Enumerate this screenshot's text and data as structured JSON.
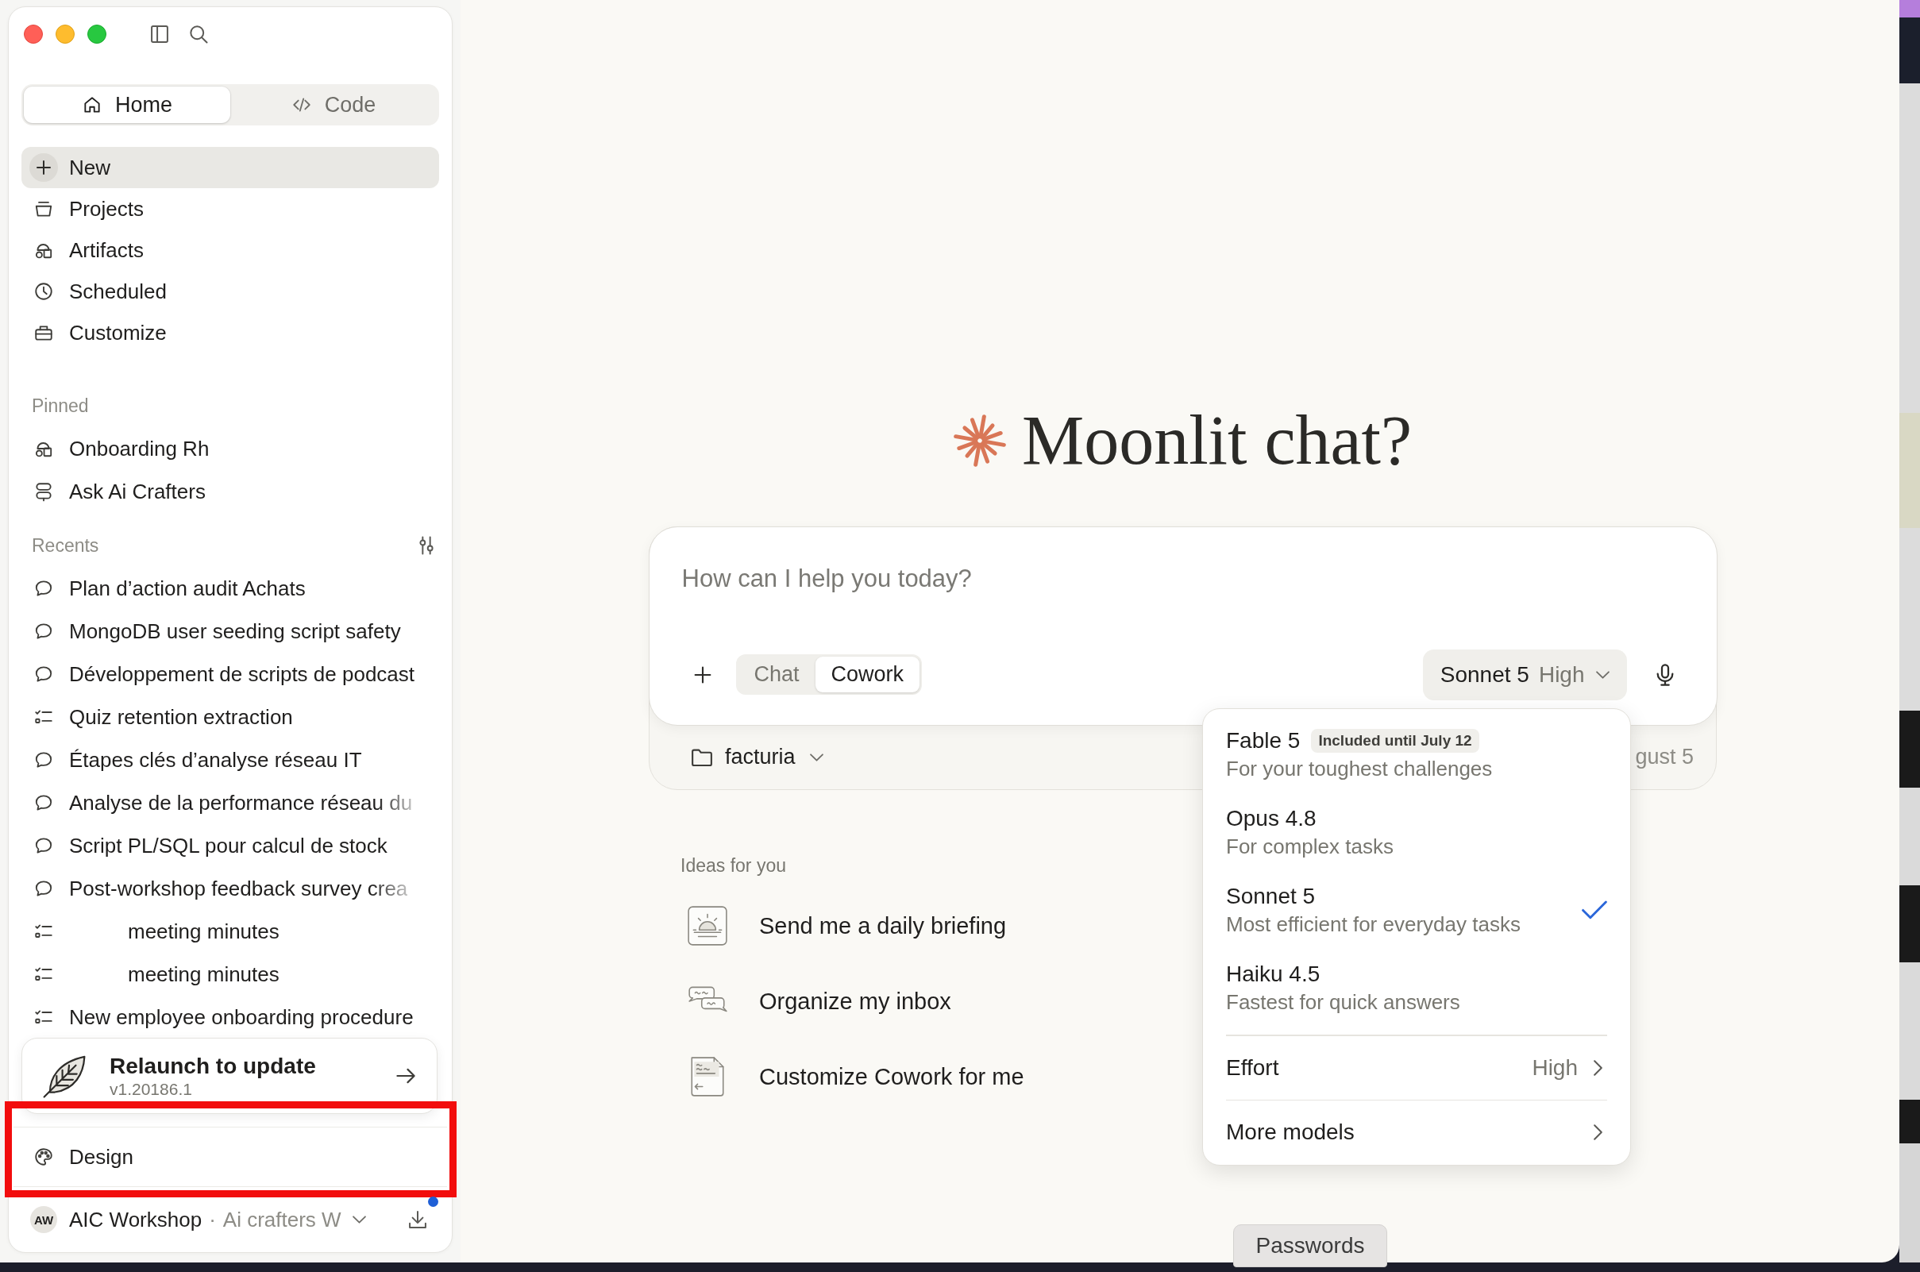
{
  "sidebar": {
    "mode_tabs": [
      {
        "label": "Home",
        "selected": true
      },
      {
        "label": "Code",
        "selected": false
      }
    ],
    "nav_items": [
      {
        "label": "New",
        "selected": true
      },
      {
        "label": "Projects",
        "selected": false
      },
      {
        "label": "Artifacts",
        "selected": false
      },
      {
        "label": "Scheduled",
        "selected": false
      },
      {
        "label": "Customize",
        "selected": false
      }
    ],
    "pinned": {
      "title": "Pinned",
      "items": [
        {
          "label": "Onboarding Rh"
        },
        {
          "label": "Ask Ai Crafters"
        }
      ]
    },
    "recents": {
      "title": "Recents",
      "items": [
        {
          "title": "Plan d’action audit Achats",
          "kind": "chat",
          "faded": false,
          "redacted": false
        },
        {
          "title": "MongoDB user seeding script safety",
          "kind": "chat",
          "faded": false,
          "redacted": false
        },
        {
          "title": "Développement de scripts de podcast",
          "kind": "chat",
          "faded": false,
          "redacted": false
        },
        {
          "title": "Quiz retention extraction",
          "kind": "task",
          "faded": false,
          "redacted": false
        },
        {
          "title": "Étapes clés d’analyse réseau IT",
          "kind": "chat",
          "faded": false,
          "redacted": false
        },
        {
          "title": "Analyse de la performance réseau du",
          "kind": "chat",
          "faded": true,
          "redacted": false
        },
        {
          "title": "Script PL/SQL pour calcul de stock",
          "kind": "chat",
          "faded": false,
          "redacted": false
        },
        {
          "title": "Post-workshop feedback survey crea",
          "kind": "chat",
          "faded": true,
          "redacted": false
        },
        {
          "title": "meeting minutes",
          "kind": "task",
          "faded": false,
          "redacted": true
        },
        {
          "title": "meeting minutes",
          "kind": "task",
          "faded": false,
          "redacted": true
        },
        {
          "title": "New employee onboarding procedure",
          "kind": "task",
          "faded": false,
          "redacted": false
        }
      ]
    },
    "update_card": {
      "title": "Relaunch to update",
      "version": "v1.20186.1"
    },
    "footer_items": [
      {
        "label": "Design",
        "highlighted": true
      }
    ],
    "account": {
      "initials": "AW",
      "name": "AIC Workshop",
      "separator": "·",
      "workspace": "Ai crafters W",
      "notification": true
    }
  },
  "main": {
    "greeting": "Moonlit chat?",
    "composer": {
      "placeholder": "How can I help you today?",
      "modes": [
        {
          "label": "Chat",
          "selected": false
        },
        {
          "label": "Cowork",
          "selected": true
        }
      ],
      "model": {
        "name": "Sonnet 5",
        "effort": "High"
      }
    },
    "context_bar": {
      "folder": "facturia",
      "trailing_text": "gust 5"
    },
    "model_menu": {
      "models": [
        {
          "name": "Fable 5",
          "badge": "Included until July 12",
          "description": "For your toughest challenges",
          "selected": false
        },
        {
          "name": "Opus 4.8",
          "description": "For complex tasks",
          "selected": false
        },
        {
          "name": "Sonnet 5",
          "description": "Most efficient for everyday tasks",
          "selected": true
        },
        {
          "name": "Haiku 4.5",
          "description": "Fastest for quick answers",
          "selected": false
        }
      ],
      "settings": [
        {
          "label": "Effort",
          "value": "High"
        },
        {
          "label": "More models"
        }
      ]
    },
    "ideas": {
      "title": "Ideas for you",
      "items": [
        {
          "label": "Send me a daily briefing"
        },
        {
          "label": "Organize my inbox"
        },
        {
          "label": "Customize Cowork for me"
        }
      ]
    }
  },
  "dock_tooltip": {
    "label": "Passwords"
  }
}
